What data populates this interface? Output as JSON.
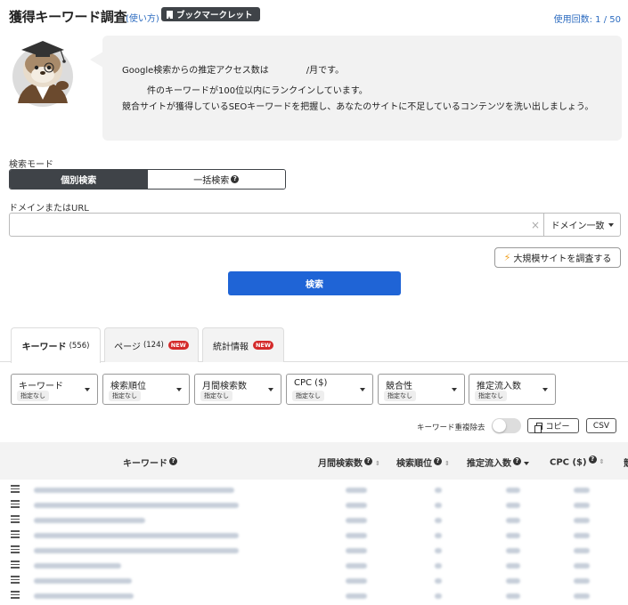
{
  "header": {
    "title": "獲得キーワード調査",
    "howto": "(使い方)",
    "bookmarklet": "ブックマークレット",
    "usage": "使用回数: 1 / 50"
  },
  "bubble": {
    "line1_a": "Google検索からの推定アクセス数は",
    "line1_b": "/月です。",
    "line2": "件のキーワードが100位以内にランクインしています。",
    "line3": "競合サイトが獲得しているSEOキーワードを把握し、あなたのサイトに不足しているコンテンツを洗い出しましょう。"
  },
  "search": {
    "mode_label": "検索モード",
    "mode_individual": "個別検索",
    "mode_bulk": "一括検索",
    "domain_label": "ドメインまたはURL",
    "url_value": "",
    "clear": "×",
    "match_select": "ドメイン一致",
    "large_site_button": "大規模サイトを調査する",
    "search_button": "検索"
  },
  "tabs": [
    {
      "label": "キーワード",
      "count": "(556)",
      "new": ""
    },
    {
      "label": "ページ",
      "count": "(124)",
      "new": "NEW"
    },
    {
      "label": "統計情報",
      "count": "",
      "new": "NEW"
    }
  ],
  "filters": [
    {
      "name": "キーワード",
      "value": "指定なし"
    },
    {
      "name": "検索順位",
      "value": "指定なし"
    },
    {
      "name": "月間検索数",
      "value": "指定なし"
    },
    {
      "name": "CPC ($)",
      "value": "指定なし"
    },
    {
      "name": "競合性",
      "value": "指定なし"
    },
    {
      "name": "推定流入数",
      "value": "指定なし"
    }
  ],
  "toolbar": {
    "dedup_label": "キーワード重複除去",
    "dedup_on": false,
    "copy": "コピー",
    "csv": "CSV"
  },
  "table": {
    "columns": [
      "キーワード",
      "月間検索数",
      "検索順位",
      "推定流入数",
      "CPC ($)",
      "競"
    ],
    "sorted_column": "推定流入数",
    "sorted_direction": "desc"
  },
  "colors": {
    "primary": "#1f64d6",
    "dark": "#3f4348",
    "badge": "#d42a2a",
    "link": "#2d6cc0"
  }
}
